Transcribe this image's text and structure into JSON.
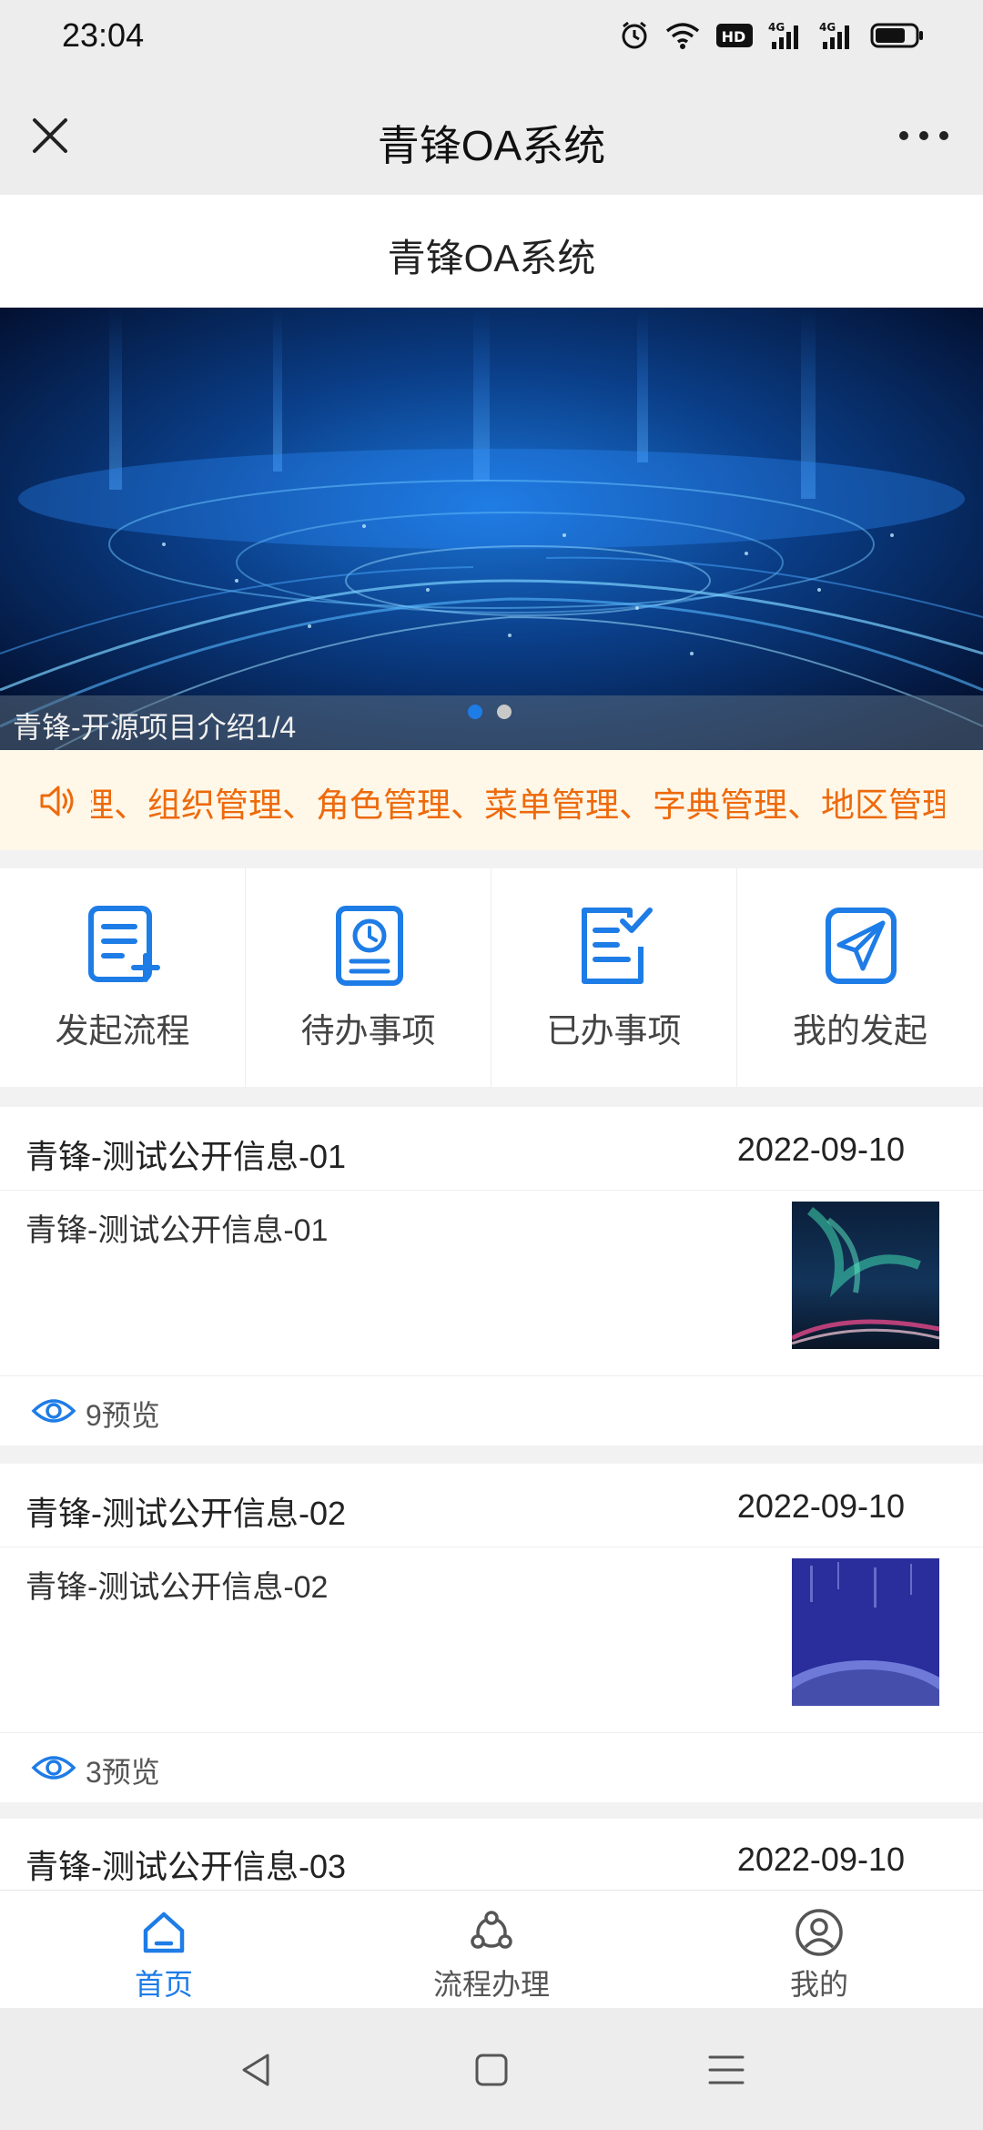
{
  "status_bar": {
    "time": "23:04",
    "icons": [
      "alarm-icon",
      "wifi-icon",
      "hd-icon",
      "signal-4g-icon",
      "signal-4g-icon",
      "battery-icon"
    ],
    "hd_label": "HD",
    "network_label": "4G"
  },
  "title_bar": {
    "title": "青锋OA系统",
    "close_icon": "close-icon",
    "more_icon": "more-icon"
  },
  "page_header": {
    "title": "青锋OA系统"
  },
  "banner": {
    "caption": "青锋-开源项目介绍1/4",
    "dots": 2,
    "active_dot": 0
  },
  "notice": {
    "icon": "speaker-icon",
    "text": "理、组织管理、角色管理、菜单管理、字典管理、地区管理"
  },
  "grid_menu": [
    {
      "label": "发起流程",
      "icon": "document-add-icon"
    },
    {
      "label": "待办事项",
      "icon": "pending-clock-icon"
    },
    {
      "label": "已办事项",
      "icon": "done-check-icon"
    },
    {
      "label": "我的发起",
      "icon": "send-icon"
    }
  ],
  "info_list": [
    {
      "title": "青锋-测试公开信息-01",
      "date": "2022-09-10",
      "desc": "青锋-测试公开信息-01",
      "views": "9预览"
    },
    {
      "title": "青锋-测试公开信息-02",
      "date": "2022-09-10",
      "desc": "青锋-测试公开信息-02",
      "views": "3预览"
    },
    {
      "title": "青锋-测试公开信息-03",
      "date": "2022-09-10"
    }
  ],
  "tab_bar": [
    {
      "label": "首页",
      "icon": "home-icon",
      "active": true
    },
    {
      "label": "流程办理",
      "icon": "process-icon",
      "active": false
    },
    {
      "label": "我的",
      "icon": "user-icon",
      "active": false
    }
  ],
  "colors": {
    "accent": "#1e7ce6",
    "notice_text": "#ed6a0c",
    "notice_bg": "#fff7e8"
  }
}
